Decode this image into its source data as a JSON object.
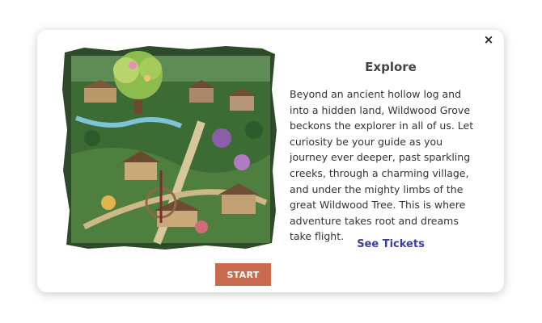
{
  "modal": {
    "close_label": "×",
    "title": "Explore",
    "body": "Beyond an ancient hollow log and into a hidden land, Wildwood Grove beckons the explorer in all of us. Let curiosity be your guide as you journey ever deeper, past sparkling creeks, through a charming village, and under the mighty limbs of the great Wildwood Tree. This is where adventure takes root and dreams take flight.",
    "link_label": "See Tickets",
    "start_label": "START"
  },
  "image": {
    "subject": "Wildwood Grove park concept art"
  },
  "colors": {
    "link": "#3a3f9e",
    "start_button": "#c96a4e"
  }
}
